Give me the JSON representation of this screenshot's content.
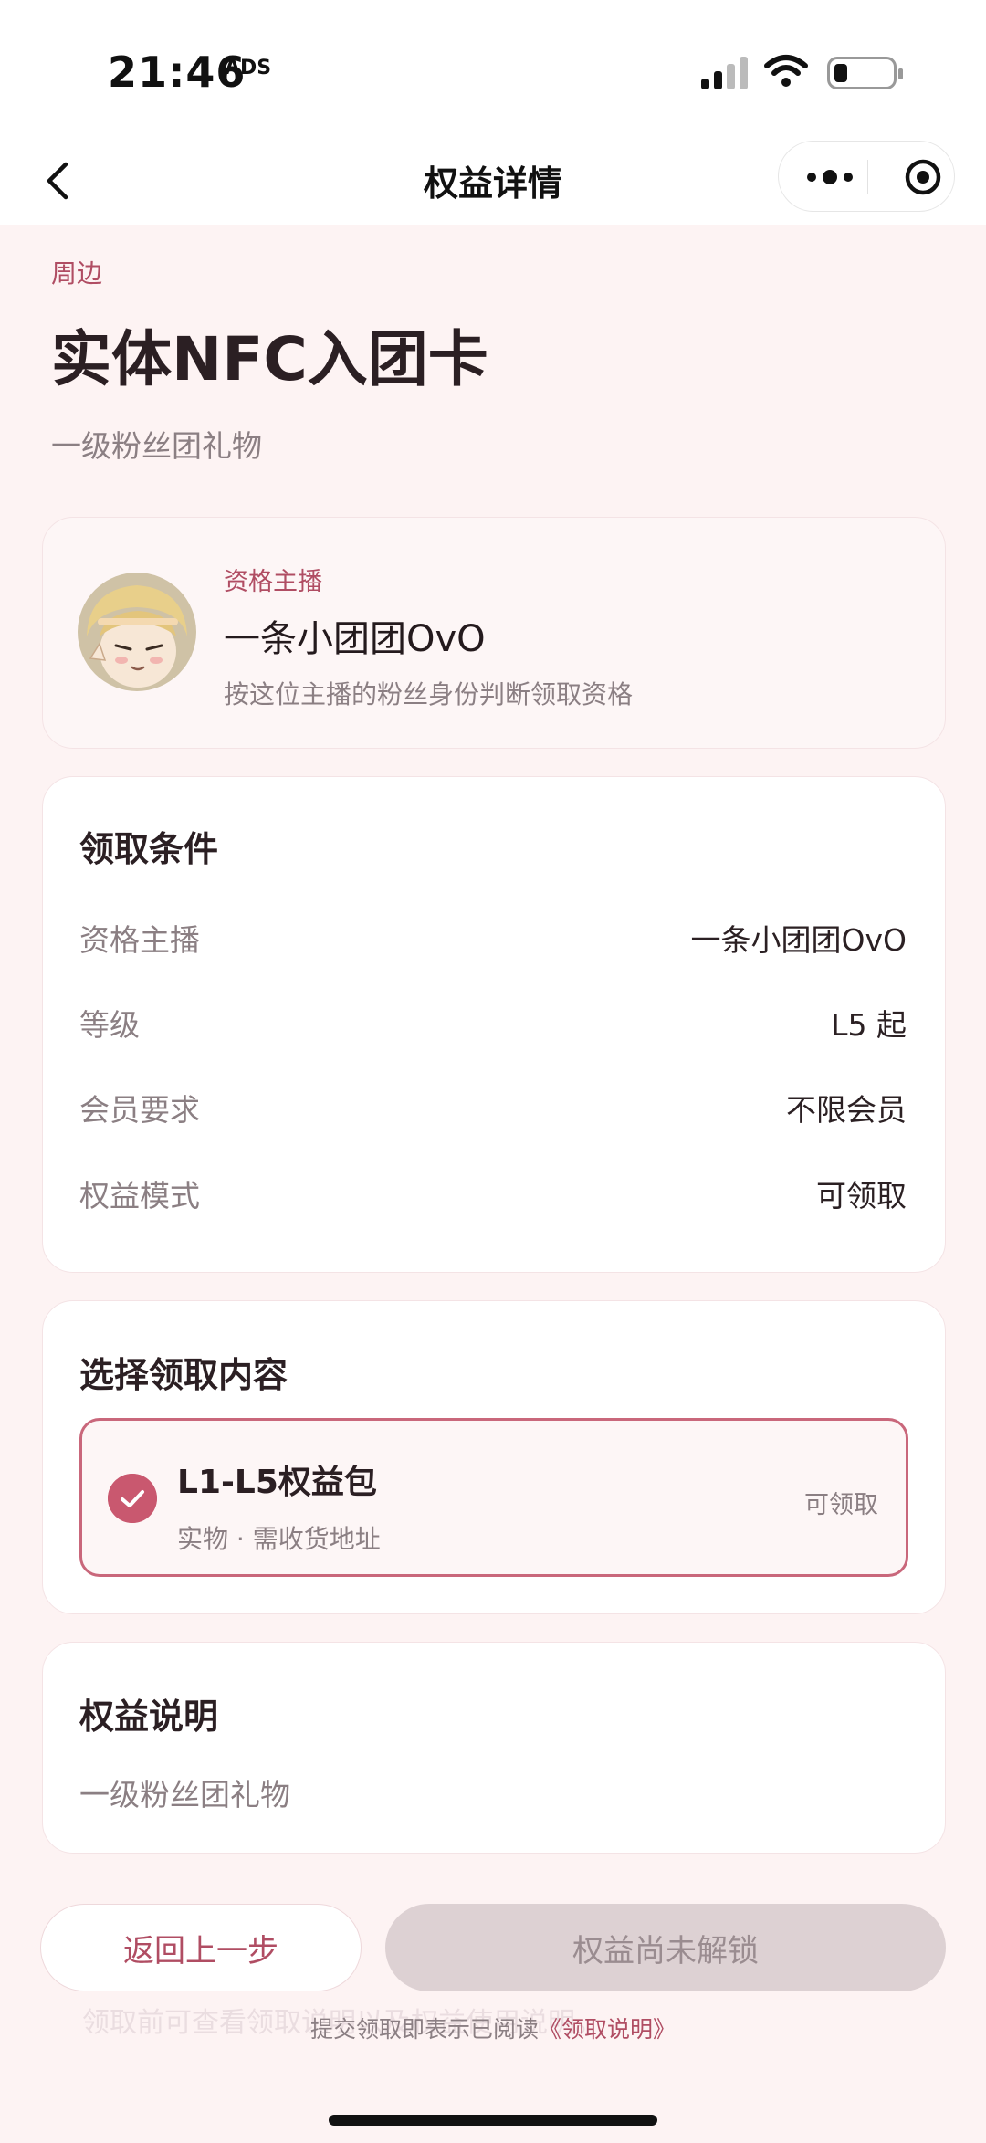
{
  "status_bar": {
    "time": "21:46",
    "ads_label": "ADS"
  },
  "nav": {
    "title": "权益详情"
  },
  "header": {
    "category": "周边",
    "title": "实体NFC入团卡",
    "subtitle": "一级粉丝团礼物"
  },
  "anchor": {
    "tag": "资格主播",
    "name": "一条小团团OvO",
    "desc": "按这位主播的粉丝身份判断领取资格"
  },
  "conditions": {
    "title": "领取条件",
    "rows": [
      {
        "label": "资格主播",
        "value": "一条小团团OvO"
      },
      {
        "label": "等级",
        "value": "L5 起"
      },
      {
        "label": "会员要求",
        "value": "不限会员"
      },
      {
        "label": "权益模式",
        "value": "可领取"
      }
    ]
  },
  "choose": {
    "title": "选择领取内容",
    "option": {
      "title": "L1-L5权益包",
      "sub": "实物 · 需收货地址",
      "status": "可领取"
    }
  },
  "description": {
    "title": "权益说明",
    "text": "一级粉丝团礼物"
  },
  "footer": {
    "back_label": "返回上一步",
    "locked_label": "权益尚未解锁",
    "agree_prefix": "提交领取即表示已阅读",
    "agree_link": "《领取说明》",
    "ghost_text": "领取前可查看领取说明以及权益使用说明。"
  },
  "colors": {
    "accent": "#b04d63",
    "check": "#c9586f",
    "background": "#fdf3f3",
    "disabled_button": "#ddd1d3"
  }
}
